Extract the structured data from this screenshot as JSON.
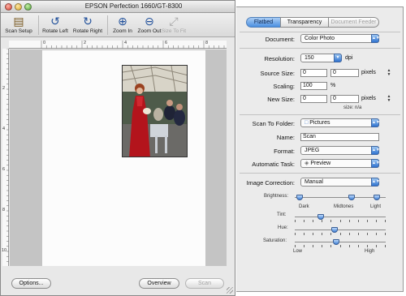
{
  "window": {
    "title": "EPSON Perfection 1660/GT-8300"
  },
  "toolbar": {
    "scan_setup": "Scan Setup",
    "rotate_left": "Rotate Left",
    "rotate_right": "Rotate Right",
    "zoom_in": "Zoom In",
    "zoom_out": "Zoom Out",
    "size_to_fit": "Size To Fit"
  },
  "ruler_top": [
    "0",
    "2",
    "4",
    "6",
    "8"
  ],
  "ruler_left": [
    "2",
    "4",
    "6",
    "8",
    "10"
  ],
  "footer": {
    "options": "Options...",
    "overview": "Overview",
    "scan": "Scan"
  },
  "tabs": [
    "Flatbed",
    "Transparency",
    "Document Feeder"
  ],
  "document": {
    "label": "Document:",
    "value": "Color Photo"
  },
  "resolution": {
    "label": "Resolution:",
    "value": "150",
    "unit": "dpi"
  },
  "source_size": {
    "label": "Source Size:",
    "width": "0",
    "height": "0",
    "unit": "pixels"
  },
  "scaling": {
    "label": "Scaling:",
    "value": "100",
    "unit": "%"
  },
  "new_size": {
    "label": "New Size:",
    "width": "0",
    "height": "0",
    "unit": "pixels",
    "note": "size:  n/a"
  },
  "scan_to_folder": {
    "label": "Scan To Folder:",
    "value": "Pictures"
  },
  "name": {
    "label": "Name:",
    "value": "Scan"
  },
  "format": {
    "label": "Format:",
    "value": "JPEG"
  },
  "automatic_task": {
    "label": "Automatic Task:",
    "value": "Preview"
  },
  "image_correction": {
    "label": "Image Correction:",
    "value": "Manual"
  },
  "brightness": {
    "label": "Brightness:",
    "dark": "Dark",
    "midtones": "Midtones",
    "light": "Light",
    "dark_level": 0.02,
    "midtones_level": 0.63,
    "light_level": 0.93
  },
  "tint": {
    "label": "Tint:",
    "level": 0.27
  },
  "hue": {
    "label": "Hue:",
    "level": 0.43
  },
  "saturation": {
    "label": "Saturation:",
    "level": 0.45,
    "low": "Low",
    "high": "High"
  },
  "accent_color": "#3d84dc"
}
